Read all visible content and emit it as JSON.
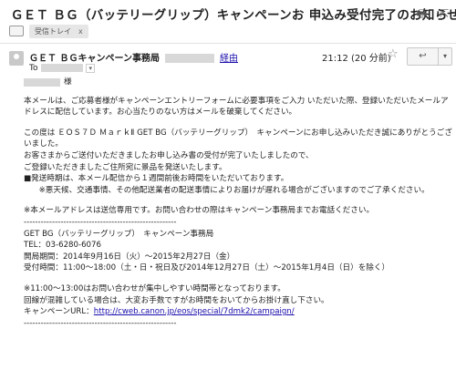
{
  "subject": "ＧＥＴ ＢＧ（バッテリーグリップ）キャンペーンお 申込み受付完了のお知らせ",
  "label": {
    "name": "受信トレイ",
    "remove": "x"
  },
  "top_icons": {
    "print": "🖶",
    "open": "⇱"
  },
  "sender": {
    "name": "ＧＥＴ ＢＧキャンペーン事務局",
    "via": "経由"
  },
  "time": "21:12 (20 分前)",
  "to_label": "To",
  "salutation": "様",
  "paragraphs": [
    [
      "本メールは、ご応募者様がキャンペーンエントリーフォームに必要事項をご入力 いただいた際、登録いただいたメールアドレスに配信しています。お心当たりのない方はメールを破棄してください。"
    ],
    [
      "この度は ＥＯＳ７Ｄ ＭａｒｋⅡ GET BG（バッテリーグリップ）　キャンペーンにお申し込みいただき誠にありがとうございました。",
      "お客さまからご送付いただきましたお申し込み書の受付が完了いたしましたので、",
      "ご登録いただきましたご住所宛に景品を発送いたします。",
      "■発送時期は、本メール配信から１週間前後お時間をいただいております。",
      "　※悪天候、交通事情、その他配送業者の配送事情によりお届けが遅れる場合がございますのでご了承ください。"
    ],
    [
      "※本メールアドレスは送信専用です。お問い合わせの際はキャンペーン事務局までお電話ください。"
    ]
  ],
  "separator": "------------------------------------------------------",
  "contact": {
    "office": "GET BG（バッテリーグリップ）　キャンペーン事務局",
    "tel": "TEL：03-6280-6076",
    "period": "開局期間：2014年9月16日（火）〜2015年2月27日（金）",
    "hours": "受付時間：11:00〜18:00（土・日・祝日及び2014年12月27日（土）〜2015年1月4日（日）を除く）"
  },
  "notes": [
    "※11:00〜13:00はお問い合わせが集中しやすい時間帯となっております。",
    "回線が混雑している場合は、大変お手数ですがお時間をおいてからお掛け直し下さい。"
  ],
  "campaign_url": {
    "label": "キャンペーンURL：",
    "url": "http://cweb.canon.jp/eos/special/7dmk2/campaign/"
  },
  "buttons": {
    "star": "☆",
    "reply": "↩",
    "more": "▾",
    "to_dropdown": "▾"
  }
}
